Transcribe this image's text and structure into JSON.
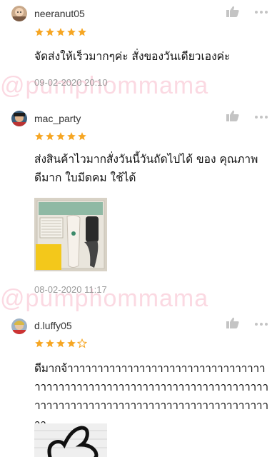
{
  "reviews": [
    {
      "username": "neeranut05",
      "rating": 5,
      "comment": "จัดส่งให้เร็วมากๆค่ะ สั่งของวันเดียวเองค่ะ",
      "timestamp": "09-02-2020 20:10"
    },
    {
      "username": "mac_party",
      "rating": 5,
      "comment": "ส่งสินค้าไวมากสั่งวันนี้วันถัดไปได้ ของ คุณภาพดีมาก ใบมีดคม ใช้ได้",
      "timestamp": "08-02-2020 11:17"
    },
    {
      "username": "d.luffy05",
      "rating": 4,
      "comment": "ดีมากจ้าาาาาาาาาาาาาาาาาาาาาาาาาาาาาาาาาาาาาาาาาาาาาาาาาาาาาาาาาาาาาาาาาาาาาาาาาาาาาาาาาาาาาาาาาาาาาาาาาาาาาาาาาาาาาาาาา"
    }
  ],
  "watermark": "@pumphommama",
  "colors": {
    "star": "#f6a623",
    "icon": "#c4c4c4",
    "watermark": "#f07896"
  },
  "icons": {
    "like": "thumbs-up-icon",
    "more": "more-dots-icon"
  }
}
